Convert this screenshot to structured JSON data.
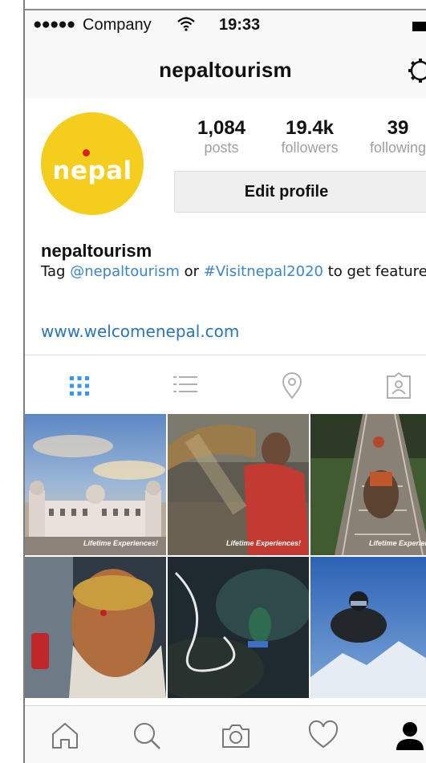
{
  "status_bar": {
    "signal": "●●●●●",
    "carrier": "Company",
    "wifi": "wifi-icon",
    "time": "19:33",
    "battery": "battery-icon"
  },
  "nav": {
    "title": "nepaltourism",
    "settings_icon": "gear-icon"
  },
  "profile": {
    "avatar_logo": "nepal",
    "stats": [
      {
        "value": "1,084",
        "label": "posts"
      },
      {
        "value": "19.4k",
        "label": "followers"
      },
      {
        "value": "39",
        "label": "following"
      }
    ],
    "edit_button": "Edit profile",
    "username": "nepaltourism",
    "bio": {
      "prefix": "Tag ",
      "mention": "@nepaltourism",
      "middle": " or ",
      "hashtag": "#Visitnepal2020",
      "suffix": " to get featured"
    },
    "website": "www.welcomenepal.com"
  },
  "view_tabs": [
    {
      "icon": "grid-icon",
      "active": true
    },
    {
      "icon": "list-icon",
      "active": false
    },
    {
      "icon": "location-pin-icon",
      "active": false
    },
    {
      "icon": "tagged-photo-icon",
      "active": false
    }
  ],
  "posts": [
    {
      "subject": "palace-under-sunset-sky",
      "caption": "Lifetime Experiences!"
    },
    {
      "subject": "woman-winnowing-grain",
      "caption": "Lifetime Experiences!"
    },
    {
      "subject": "mule-on-suspension-bridge",
      "caption": "Lifetime Experiences!"
    },
    {
      "subject": "sadhu-portrait",
      "caption": ""
    },
    {
      "subject": "bungee-jumper-over-gorge",
      "caption": ""
    },
    {
      "subject": "skydiver-over-mountains",
      "caption": ""
    }
  ],
  "tab_bar": [
    {
      "icon": "home-icon"
    },
    {
      "icon": "search-icon"
    },
    {
      "icon": "camera-icon"
    },
    {
      "icon": "heart-icon"
    },
    {
      "icon": "profile-icon"
    }
  ],
  "colors": {
    "accent_link": "#3b85c9",
    "avatar_bg": "#f5cd1c",
    "active_tab": "#3897f0"
  }
}
